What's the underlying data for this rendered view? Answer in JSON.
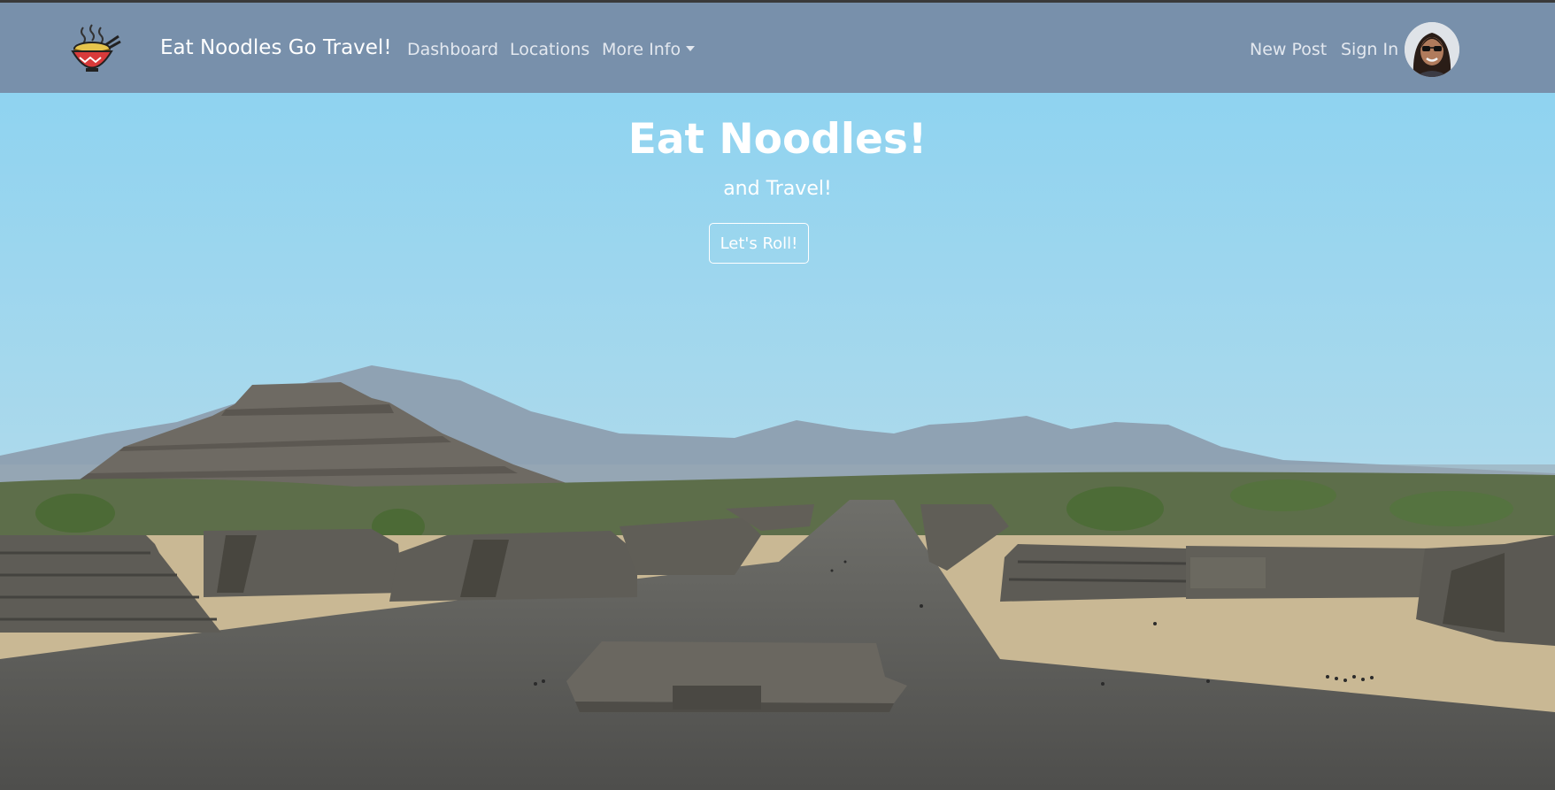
{
  "navbar": {
    "brand": "Eat Noodles Go Travel!",
    "links": [
      "Dashboard",
      "Locations",
      "More Info"
    ],
    "new_post": "New Post",
    "sign_in": "Sign In",
    "background": "#7890ab"
  },
  "icons": {
    "logo": "noodle-bowl-icon",
    "avatar": "user-avatar",
    "dropdown": "caret-down-icon"
  },
  "hero": {
    "title": "Eat Noodles!",
    "subtitle": "and Travel!",
    "button": "Let's Roll!"
  }
}
